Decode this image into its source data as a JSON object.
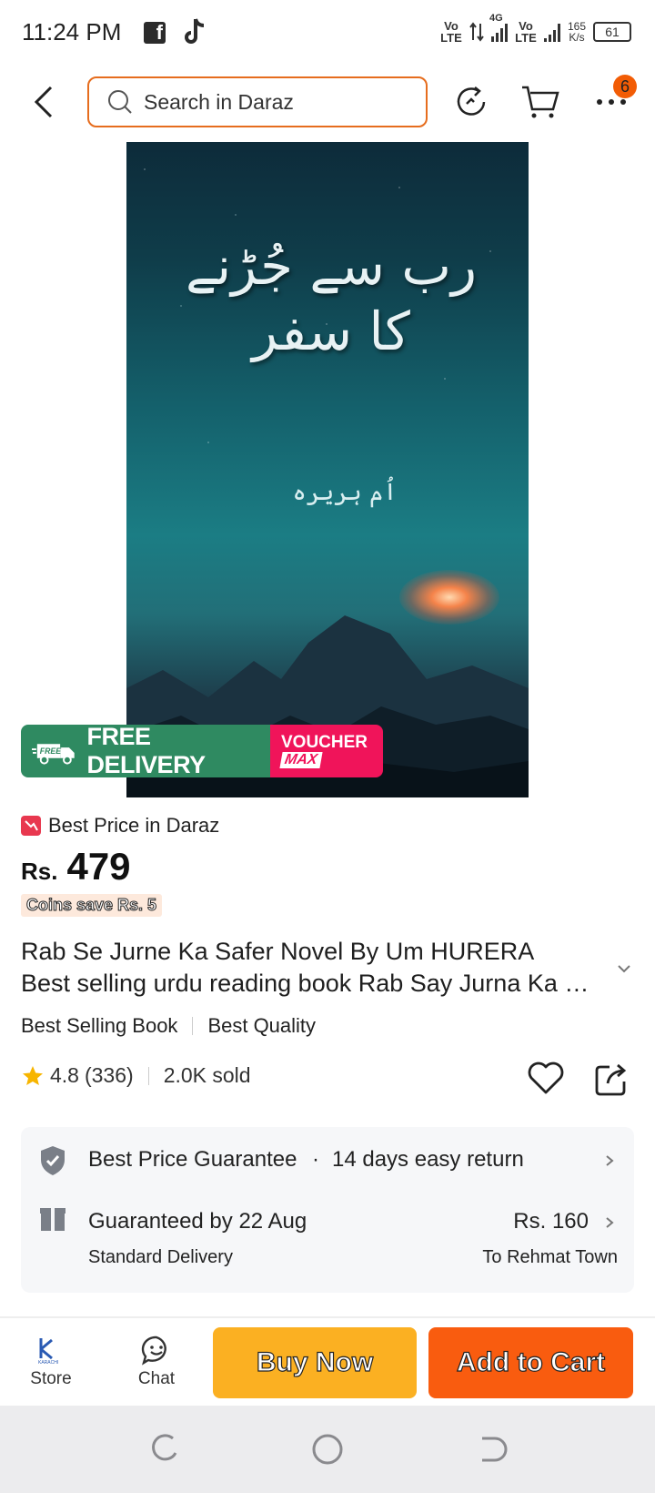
{
  "status_bar": {
    "time": "11:24 PM",
    "facebook_glyph": "f",
    "sim1": "Vo LTE",
    "network": "4G",
    "sim2": "Vo LTE",
    "speed_value": "165",
    "speed_unit": "K/s",
    "battery": "61"
  },
  "header": {
    "search_placeholder": "Search in Daraz",
    "cart_badge": "6"
  },
  "product_image": {
    "cover_title": "رب سے جُڑنے کا سفر",
    "cover_author": "اُم ہریرہ"
  },
  "promo": {
    "free_tag": "FREE",
    "free_delivery": "FREE DELIVERY",
    "voucher": "VOUCHER",
    "max": "MAX"
  },
  "price": {
    "best_price_label": "Best Price in Daraz",
    "currency": "Rs.",
    "amount": "479",
    "coins_text": "Coins save Rs. 5"
  },
  "product": {
    "title_line1": "Rab Se Jurne Ka Safer Novel By Um HURERA",
    "title_line2": "Best selling urdu reading book Rab Say Jurna Ka Safar",
    "tags": [
      "Best Selling Book",
      "Best Quality"
    ],
    "rating": "4.8",
    "reviews": "(336)",
    "sold": "2.0K sold"
  },
  "info": {
    "guarantee": "Best Price Guarantee",
    "dot": "·",
    "returns": "14 days easy return",
    "delivery_date": "Guaranteed by 22 Aug",
    "delivery_type": "Standard Delivery",
    "delivery_fee": "Rs. 160",
    "delivery_to": "To Rehmat Town"
  },
  "actions": {
    "store_label": "Store",
    "store_logo_text": "KARACHI",
    "chat_label": "Chat",
    "buy_now": "Buy Now",
    "add_to_cart": "Add to Cart"
  },
  "colors": {
    "accent": "#f95c0f",
    "buy_now": "#fbb022",
    "free_delivery": "#2f8a61",
    "voucher": "#f0145a",
    "star": "#f7b500"
  },
  "icons": {
    "back": "chevron-left-icon",
    "search": "search-icon",
    "history": "history-icon",
    "cart": "cart-icon",
    "more": "more-icon",
    "wishlist": "heart-icon",
    "share": "share-icon",
    "shield": "shield-check-icon",
    "delivery": "package-icon",
    "chat": "chat-icon"
  }
}
